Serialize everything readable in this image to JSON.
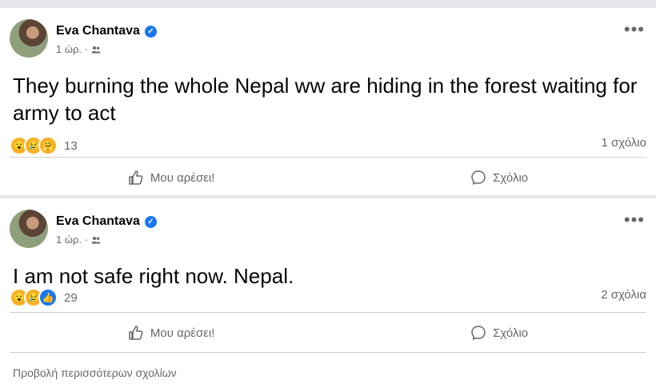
{
  "posts": [
    {
      "author": "Eva Chantava",
      "time": "1 ώρ. ·",
      "text": "They burning the whole Nepal ww are hiding in the forest waiting for army to act",
      "reaction_count": "13",
      "reaction_icons": [
        "wow-icon",
        "sad-icon",
        "care-icon"
      ],
      "comments": "1 σχόλιο"
    },
    {
      "author": "Eva Chantava",
      "time": "1 ώρ. ·",
      "text": "I am not safe right now. Nepal.",
      "reaction_count": "29",
      "reaction_icons": [
        "wow-icon",
        "sad-icon",
        "like-icon"
      ],
      "comments": "2 σχόλια"
    }
  ],
  "actions": {
    "like_label": "Μου αρέσει!",
    "comment_label": "Σχόλιο"
  },
  "more_comments_label": "Προβολή περισσότερων σχολίων",
  "colors": {
    "verified": "#1877f2",
    "secondary_text": "#65676b",
    "background": "#e4e6ea"
  }
}
